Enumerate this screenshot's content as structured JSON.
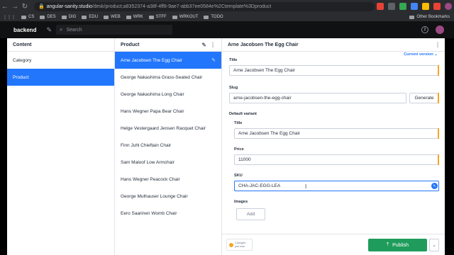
{
  "browser": {
    "url_host": "angular-sanity.studio",
    "url_path": "/desk/product;a8352374-a38f-4ff8-9ae7-abb37ee0584e%2Ctemplate%3Dproduct",
    "bookmarks": [
      "CS",
      "DES",
      "DIG",
      "EDU",
      "WEB",
      "WRK",
      "STFF",
      "WRKOUT",
      "TODO"
    ],
    "other_bookmarks": "Other Bookmarks"
  },
  "studio": {
    "brand": "backend",
    "search_placeholder": "Search",
    "avatar_count": "2"
  },
  "content_pane": {
    "title": "Content",
    "items": [
      "Category",
      "Product"
    ],
    "selected": "Product"
  },
  "product_pane": {
    "title": "Product",
    "items": [
      "Arne Jacobsen The Egg Chair",
      "George Nakashima Grass-Seated Chair",
      "George Nakashima Long Chair",
      "Hans Wegner Papa Bear Chair",
      "Helge Vestergaard Jensen Racquet Chair",
      "Finn Juhl Chieftain Chair",
      "Sam Maloof Low Armchair",
      "Hans Wegner Peacock Chair",
      "George Mulhauser Lounge Chair",
      "Eero Saarinen Womb Chair"
    ],
    "selected": "Arne Jacobsen The Egg Chair"
  },
  "document": {
    "title": "Arne Jacobsen The Egg Chair",
    "version": "Current version ⌄",
    "fields": {
      "title_label": "Title",
      "title_value": "Arne Jacobsen The Egg Chair",
      "slug_label": "Slug",
      "slug_value": "arne-jacobsen-the-egg-chair",
      "generate_label": "Generate",
      "variant_label": "Default variant",
      "variant_title_label": "Title",
      "variant_title_value": "Arne Jacobsen The Egg Chair",
      "price_label": "Price",
      "price_value": "11000",
      "sku_label": "SKU",
      "sku_value": "CHA-JAC-EGG-LEA",
      "images_label": "Images",
      "add_label": "Add"
    }
  },
  "footer": {
    "changes_line1": "Changes",
    "changes_line2": "just now",
    "publish_label": "Publish"
  },
  "colors": {
    "accent": "#2276fc",
    "publish": "#1f9c5b",
    "warning": "#f5a623"
  }
}
